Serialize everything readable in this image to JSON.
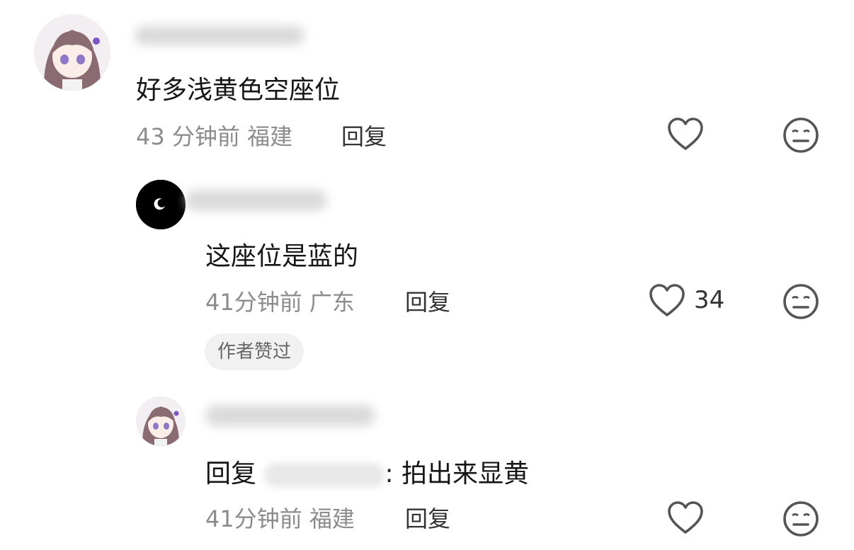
{
  "comments": [
    {
      "text": "好多浅黄色空座位",
      "time": "43 分钟前",
      "location": "福建",
      "reply_label": "回复"
    },
    {
      "text": "这座位是蓝的",
      "time": "41分钟前",
      "location": "广东",
      "reply_label": "回复",
      "like_count": "34",
      "badge": "作者赞过"
    },
    {
      "reply_prefix": "回复",
      "reply_suffix": ": 拍出来显黄",
      "time": "41分钟前",
      "location": "福建",
      "reply_label": "回复"
    }
  ],
  "icons": {
    "like": "heart-outline-icon",
    "dislike": "meh-face-icon"
  },
  "colors": {
    "meta": "#8c8c8c",
    "text": "#161616",
    "icon": "#555555"
  }
}
